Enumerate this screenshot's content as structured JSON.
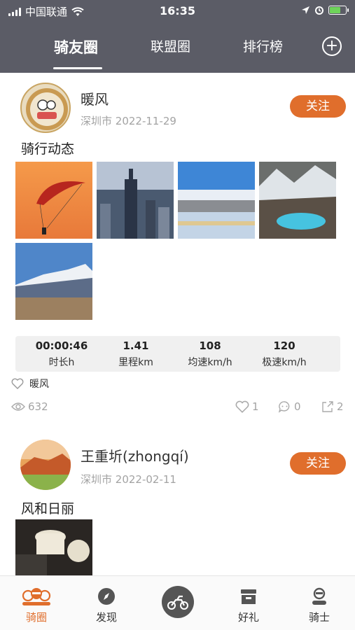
{
  "status_bar": {
    "carrier": "中国联通",
    "time": "16:35"
  },
  "top_tabs": [
    {
      "label": "骑友圈",
      "active": true
    },
    {
      "label": "联盟圈",
      "active": false
    },
    {
      "label": "排行榜",
      "active": false
    }
  ],
  "posts": [
    {
      "username": "暖风",
      "location": "深圳市",
      "date": "2022-11-29",
      "follow_label": "关注",
      "title": "骑行动态",
      "stats": [
        {
          "value": "00:00:46",
          "label": "时长h"
        },
        {
          "value": "1.41",
          "label": "里程km"
        },
        {
          "value": "108",
          "label": "均速km/h"
        },
        {
          "value": "120",
          "label": "极速km/h"
        }
      ],
      "liked_by": "暖风",
      "views": "632",
      "likes": "1",
      "comments": "0",
      "shares": "2"
    },
    {
      "username": "王重圻(zhongqí)",
      "location": "深圳市",
      "date": "2022-02-11",
      "follow_label": "关注",
      "title": "风和日丽"
    }
  ],
  "bottom_nav": [
    {
      "label": "骑圈",
      "active": true
    },
    {
      "label": "发现",
      "active": false
    },
    {
      "label": "好礼",
      "active": false
    },
    {
      "label": "骑士",
      "active": false
    }
  ],
  "colors": {
    "header_bg": "#5b5c66",
    "accent": "#e06e2c"
  }
}
